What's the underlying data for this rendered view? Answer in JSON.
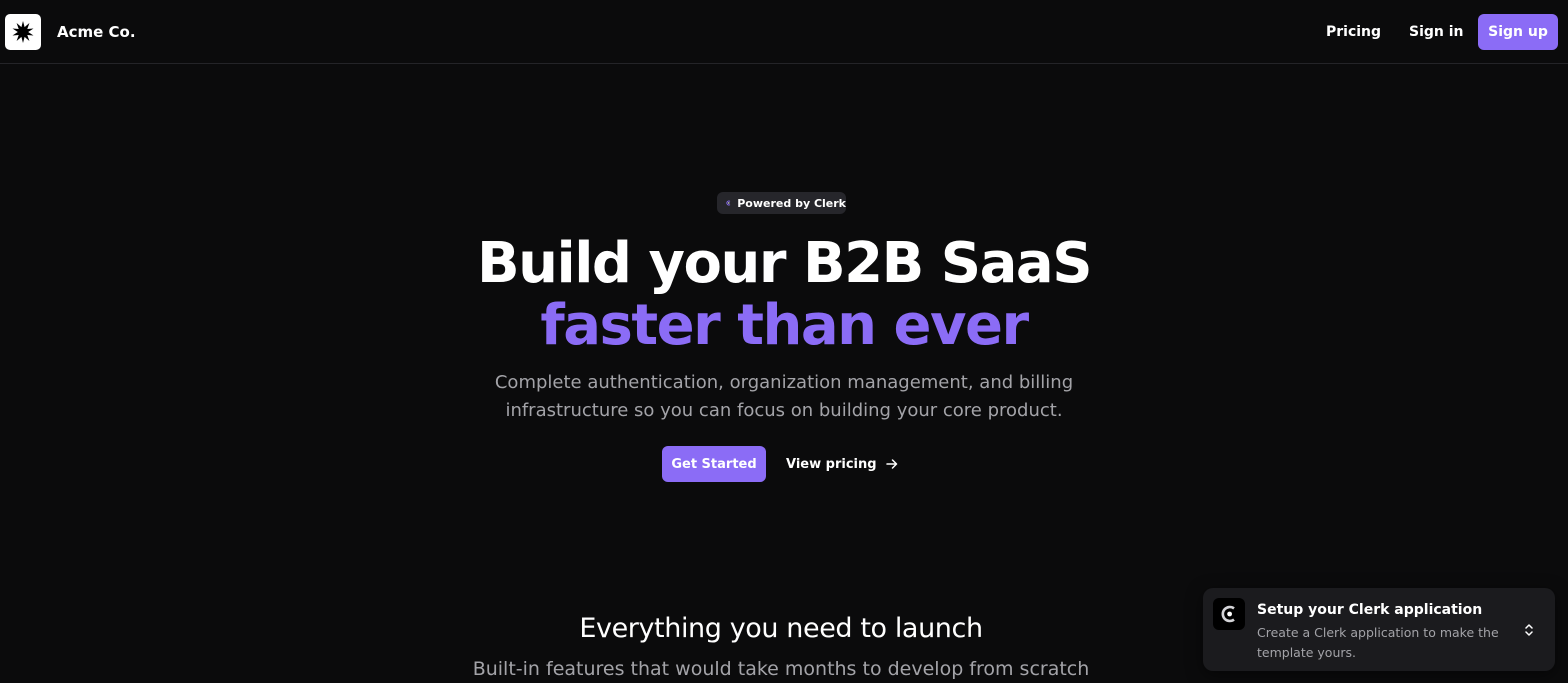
{
  "header": {
    "brand_name": "Acme Co.",
    "logo_icon": "starburst-icon",
    "nav": {
      "pricing_label": "Pricing",
      "signin_label": "Sign in",
      "signup_label": "Sign up"
    }
  },
  "hero": {
    "badge": {
      "icon": "clerk-logo-icon",
      "label": "Powered by Clerk"
    },
    "title_line_1": "Build your B2B SaaS",
    "title_line_2": "faster than ever",
    "subtitle": "Complete authentication, organization management, and billing infrastructure so you can focus on building your core product.",
    "primary_cta": "Get Started",
    "secondary_cta": "View pricing",
    "secondary_cta_icon": "arrow-right-icon"
  },
  "features": {
    "title": "Everything you need to launch",
    "subtitle": "Built-in features that would take months to develop from scratch"
  },
  "toast": {
    "icon": "clerk-logo-icon",
    "title": "Setup your Clerk application",
    "description": "Create a Clerk application to make the template yours.",
    "toggle_icon": "chevron-up-down-icon"
  },
  "colors": {
    "background": "#0b0b0c",
    "accent": "#8b6cf6",
    "muted_text": "#a3a3a8",
    "badge_bg": "#26262b",
    "toast_bg": "#1b1b1e"
  }
}
